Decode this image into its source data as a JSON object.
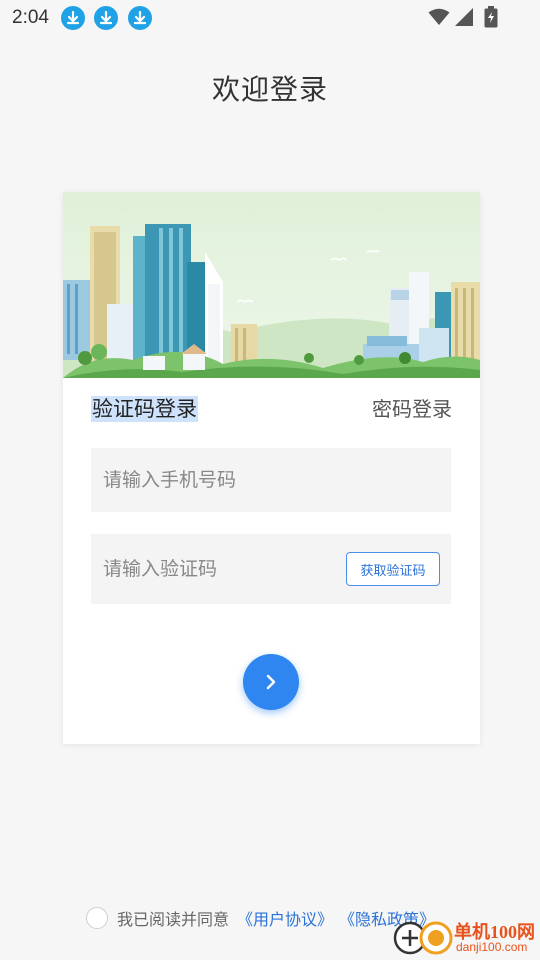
{
  "status_bar": {
    "time": "2:04",
    "notification_icons": [
      "download-icon",
      "download-icon",
      "download-icon"
    ],
    "system_icons": [
      "wifi-icon",
      "signal-icon",
      "battery-icon"
    ]
  },
  "page": {
    "title": "欢迎登录"
  },
  "login": {
    "tab_sms": "验证码登录",
    "tab_password": "密码登录",
    "phone_placeholder": "请输入手机号码",
    "code_placeholder": "请输入验证码",
    "get_code_label": "获取验证码",
    "submit_icon": "chevron-right-icon"
  },
  "agreement": {
    "text": "我已阅读并同意",
    "user_agreement": "《用户协议》",
    "privacy_policy": "《隐私政策》"
  },
  "watermark": {
    "name": "单机100网",
    "domain": "danji100.com"
  },
  "colors": {
    "accent": "#2f86f0",
    "link": "#2a72d8",
    "background": "#f6f6f6"
  }
}
